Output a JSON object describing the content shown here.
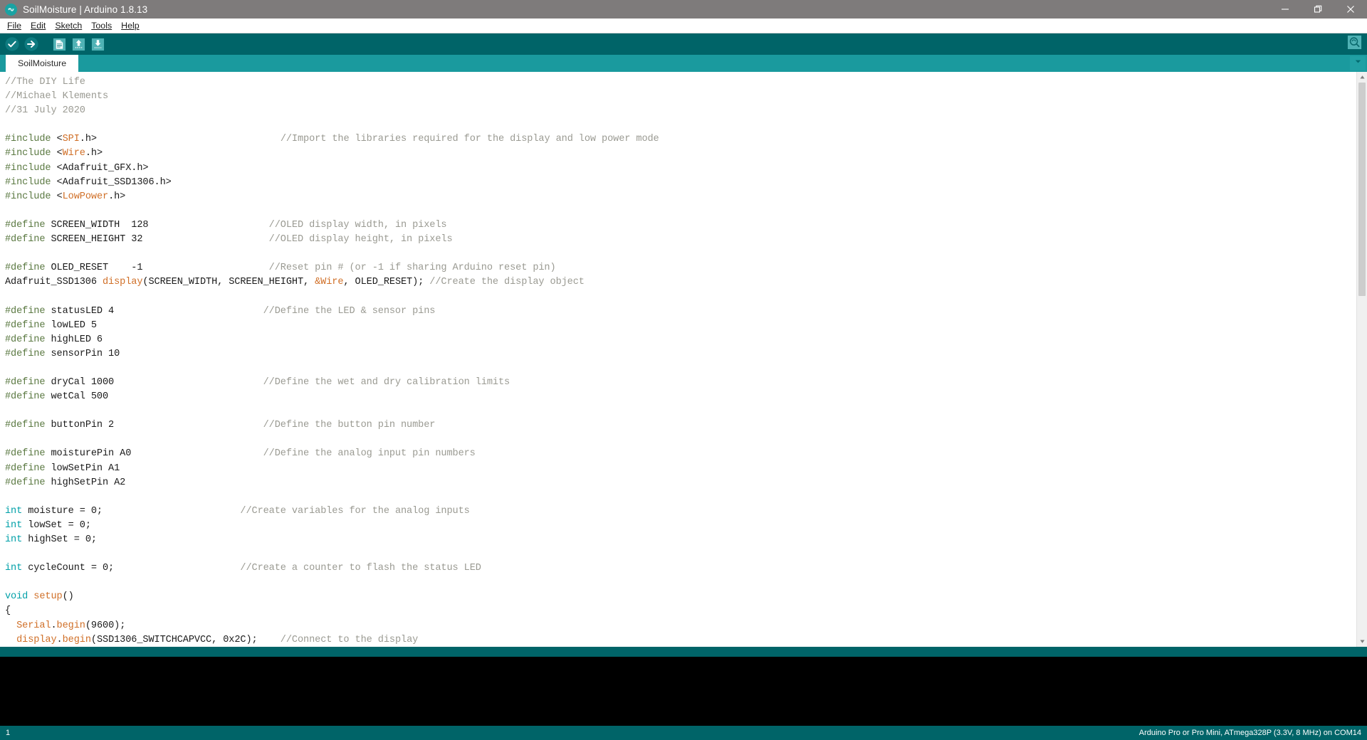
{
  "window": {
    "title": "SoilMoisture | Arduino 1.8.13",
    "logo_icon": "arduino-infinity-logo",
    "controls": {
      "minimize": "minimize-icon",
      "maximize": "maximize-icon",
      "close": "close-icon"
    }
  },
  "menubar": {
    "items": [
      {
        "label": "File",
        "mnemonic": "F"
      },
      {
        "label": "Edit",
        "mnemonic": "E"
      },
      {
        "label": "Sketch",
        "mnemonic": "S"
      },
      {
        "label": "Tools",
        "mnemonic": "T"
      },
      {
        "label": "Help",
        "mnemonic": "H"
      }
    ]
  },
  "toolbar": {
    "buttons": [
      {
        "name": "verify-button",
        "icon": "check-circle-icon",
        "tooltip": "Verify"
      },
      {
        "name": "upload-button",
        "icon": "arrow-right-circle-icon",
        "tooltip": "Upload"
      },
      {
        "name": "new-button",
        "icon": "new-file-icon",
        "tooltip": "New"
      },
      {
        "name": "open-button",
        "icon": "open-folder-up-arrow-icon",
        "tooltip": "Open"
      },
      {
        "name": "save-button",
        "icon": "save-down-arrow-icon",
        "tooltip": "Save"
      }
    ],
    "serial_monitor": {
      "name": "serial-monitor-button",
      "icon": "magnifier-icon",
      "tooltip": "Serial Monitor"
    }
  },
  "tabs": {
    "items": [
      {
        "label": "SoilMoisture",
        "active": true
      }
    ],
    "dropdown_icon": "chevron-down-icon"
  },
  "editor": {
    "lines": [
      [
        {
          "t": "//The DIY Life",
          "c": "cm"
        }
      ],
      [
        {
          "t": "//Michael Klements",
          "c": "cm"
        }
      ],
      [
        {
          "t": "//31 July 2020",
          "c": "cm"
        }
      ],
      [
        {
          "t": "",
          "c": ""
        }
      ],
      [
        {
          "t": "#include ",
          "c": "pp"
        },
        {
          "t": "<",
          "c": ""
        },
        {
          "t": "SPI",
          "c": "lit"
        },
        {
          "t": ".h>",
          "c": ""
        },
        {
          "t": "                                ",
          "c": ""
        },
        {
          "t": "//Import the libraries required for the display and low power mode",
          "c": "cm"
        }
      ],
      [
        {
          "t": "#include ",
          "c": "pp"
        },
        {
          "t": "<",
          "c": ""
        },
        {
          "t": "Wire",
          "c": "lit"
        },
        {
          "t": ".h>",
          "c": ""
        }
      ],
      [
        {
          "t": "#include ",
          "c": "pp"
        },
        {
          "t": "<Adafruit_GFX.h>",
          "c": ""
        }
      ],
      [
        {
          "t": "#include ",
          "c": "pp"
        },
        {
          "t": "<Adafruit_SSD1306.h>",
          "c": ""
        }
      ],
      [
        {
          "t": "#include ",
          "c": "pp"
        },
        {
          "t": "<",
          "c": ""
        },
        {
          "t": "LowPower",
          "c": "lit"
        },
        {
          "t": ".h>",
          "c": ""
        }
      ],
      [
        {
          "t": "",
          "c": ""
        }
      ],
      [
        {
          "t": "#define ",
          "c": "pp"
        },
        {
          "t": "SCREEN_WIDTH  128",
          "c": ""
        },
        {
          "t": "                     ",
          "c": ""
        },
        {
          "t": "//OLED display width, in pixels",
          "c": "cm"
        }
      ],
      [
        {
          "t": "#define ",
          "c": "pp"
        },
        {
          "t": "SCREEN_HEIGHT 32",
          "c": ""
        },
        {
          "t": "                      ",
          "c": ""
        },
        {
          "t": "//OLED display height, in pixels",
          "c": "cm"
        }
      ],
      [
        {
          "t": "",
          "c": ""
        }
      ],
      [
        {
          "t": "#define ",
          "c": "pp"
        },
        {
          "t": "OLED_RESET    -1",
          "c": ""
        },
        {
          "t": "                      ",
          "c": ""
        },
        {
          "t": "//Reset pin # (or -1 if sharing Arduino reset pin)",
          "c": "cm"
        }
      ],
      [
        {
          "t": "Adafruit_SSD1306 ",
          "c": ""
        },
        {
          "t": "display",
          "c": "fn"
        },
        {
          "t": "(SCREEN_WIDTH, SCREEN_HEIGHT, ",
          "c": ""
        },
        {
          "t": "&Wire",
          "c": "lit"
        },
        {
          "t": ", OLED_RESET); ",
          "c": ""
        },
        {
          "t": "//Create the display object",
          "c": "cm"
        }
      ],
      [
        {
          "t": "",
          "c": ""
        }
      ],
      [
        {
          "t": "#define ",
          "c": "pp"
        },
        {
          "t": "statusLED 4",
          "c": ""
        },
        {
          "t": "                          ",
          "c": ""
        },
        {
          "t": "//Define the LED & sensor pins",
          "c": "cm"
        }
      ],
      [
        {
          "t": "#define ",
          "c": "pp"
        },
        {
          "t": "lowLED 5",
          "c": ""
        }
      ],
      [
        {
          "t": "#define ",
          "c": "pp"
        },
        {
          "t": "highLED 6",
          "c": ""
        }
      ],
      [
        {
          "t": "#define ",
          "c": "pp"
        },
        {
          "t": "sensorPin 10",
          "c": ""
        }
      ],
      [
        {
          "t": "",
          "c": ""
        }
      ],
      [
        {
          "t": "#define ",
          "c": "pp"
        },
        {
          "t": "dryCal 1000",
          "c": ""
        },
        {
          "t": "                          ",
          "c": ""
        },
        {
          "t": "//Define the wet and dry calibration limits",
          "c": "cm"
        }
      ],
      [
        {
          "t": "#define ",
          "c": "pp"
        },
        {
          "t": "wetCal 500",
          "c": ""
        }
      ],
      [
        {
          "t": "",
          "c": ""
        }
      ],
      [
        {
          "t": "#define ",
          "c": "pp"
        },
        {
          "t": "buttonPin 2",
          "c": ""
        },
        {
          "t": "                          ",
          "c": ""
        },
        {
          "t": "//Define the button pin number",
          "c": "cm"
        }
      ],
      [
        {
          "t": "",
          "c": ""
        }
      ],
      [
        {
          "t": "#define ",
          "c": "pp"
        },
        {
          "t": "moisturePin A0",
          "c": ""
        },
        {
          "t": "                       ",
          "c": ""
        },
        {
          "t": "//Define the analog input pin numbers",
          "c": "cm"
        }
      ],
      [
        {
          "t": "#define ",
          "c": "pp"
        },
        {
          "t": "lowSetPin A1",
          "c": ""
        }
      ],
      [
        {
          "t": "#define ",
          "c": "pp"
        },
        {
          "t": "highSetPin A2",
          "c": ""
        }
      ],
      [
        {
          "t": "",
          "c": ""
        }
      ],
      [
        {
          "t": "int",
          "c": "kw"
        },
        {
          "t": " moisture = 0;",
          "c": ""
        },
        {
          "t": "                        ",
          "c": ""
        },
        {
          "t": "//Create variables for the analog inputs",
          "c": "cm"
        }
      ],
      [
        {
          "t": "int",
          "c": "kw"
        },
        {
          "t": " lowSet = 0;",
          "c": ""
        }
      ],
      [
        {
          "t": "int",
          "c": "kw"
        },
        {
          "t": " highSet = 0;",
          "c": ""
        }
      ],
      [
        {
          "t": "",
          "c": ""
        }
      ],
      [
        {
          "t": "int",
          "c": "kw"
        },
        {
          "t": " cycleCount = 0;",
          "c": ""
        },
        {
          "t": "                      ",
          "c": ""
        },
        {
          "t": "//Create a counter to flash the status LED",
          "c": "cm"
        }
      ],
      [
        {
          "t": "",
          "c": ""
        }
      ],
      [
        {
          "t": "void",
          "c": "kw"
        },
        {
          "t": " ",
          "c": ""
        },
        {
          "t": "setup",
          "c": "fn"
        },
        {
          "t": "()",
          "c": ""
        }
      ],
      [
        {
          "t": "{",
          "c": ""
        }
      ],
      [
        {
          "t": "  ",
          "c": ""
        },
        {
          "t": "Serial",
          "c": "fn"
        },
        {
          "t": ".",
          "c": ""
        },
        {
          "t": "begin",
          "c": "fn"
        },
        {
          "t": "(9600);",
          "c": ""
        }
      ],
      [
        {
          "t": "  ",
          "c": ""
        },
        {
          "t": "display",
          "c": "fn"
        },
        {
          "t": ".",
          "c": ""
        },
        {
          "t": "begin",
          "c": "fn"
        },
        {
          "t": "(SSD1306_SWITCHCAPVCC, 0x2C);    ",
          "c": ""
        },
        {
          "t": "//Connect to the display",
          "c": "cm"
        }
      ]
    ]
  },
  "console": {
    "output": ""
  },
  "statusbar": {
    "line_number": "1",
    "board_info": "Arduino Pro or Pro Mini, ATmega328P (3.3V, 8 MHz) on COM14"
  },
  "colors": {
    "titlebar_bg": "#7e7b7b",
    "toolbar_bg": "#006468",
    "tabbar_bg": "#1a9a9e",
    "editor_bg": "#ffffff",
    "console_bg": "#000000",
    "statusbar_bg": "#006468",
    "comment": "#9a9a92",
    "preprocessor": "#5b7942",
    "literal": "#d06f27",
    "keyword": "#00a0a8"
  }
}
